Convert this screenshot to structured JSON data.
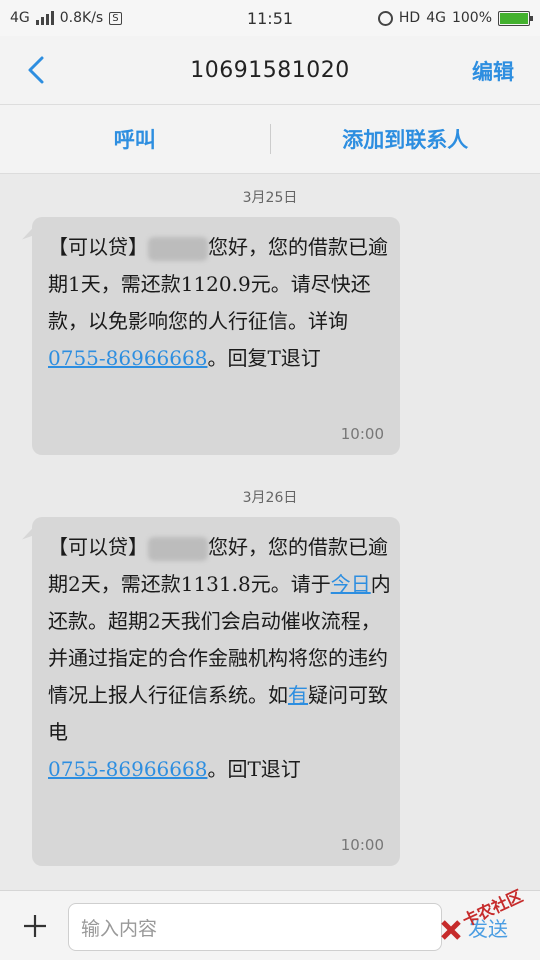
{
  "status_bar": {
    "network": "4G",
    "speed": "0.8K/s",
    "sim_badge": "S",
    "time": "11:51",
    "hd": "HD",
    "network2": "4G",
    "battery": "100%",
    "battery_color": "#43b12e"
  },
  "header": {
    "title": "10691581020",
    "edit_label": "编辑"
  },
  "actions": {
    "call_label": "呼叫",
    "add_contact_label": "添加到联系人"
  },
  "messages": [
    {
      "date": "3月25日",
      "part1": "【可以贷】",
      "part2": "您好，您的借款已逾期1天，需还款1120.9元。请尽快还款，以免影响您的人行征信。详询",
      "phone": "0755-86966668",
      "part3": "。回复T退订",
      "time": "10:00"
    },
    {
      "date": "3月26日",
      "part1": "【可以贷】",
      "part2": "您好，您的借款已逾期2天，需还款1131.8元。请于",
      "link_today": "今日",
      "part3": "内还款。超期2天我们会启动催收流程，并通过指定的合作金融机构将您的违约情况上报人行征信系统。如",
      "link_you": "有",
      "part4": "疑问可致电",
      "phone": "0755-86966668",
      "part5": "。回T退订",
      "time": "10:00"
    }
  ],
  "composer": {
    "placeholder": "输入内容",
    "send_label": "发送",
    "watermark": "卡农社区"
  },
  "colors": {
    "accent": "#2d8ee0",
    "bubble": "#d7d7d7"
  }
}
